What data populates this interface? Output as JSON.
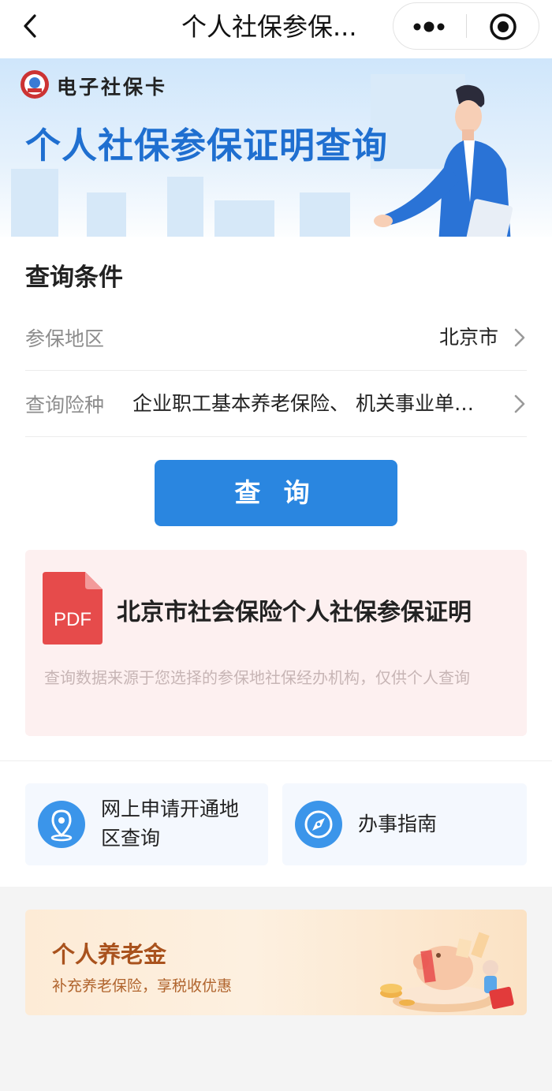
{
  "navbar": {
    "title": "个人社保参保...",
    "back_icon": "chevron-left-icon",
    "more_icon": "more-dots-icon",
    "close_icon": "target-circle-icon"
  },
  "banner": {
    "brand": "电子社保卡",
    "title": "个人社保参保证明查询",
    "logo_icon": "social-security-seal-icon"
  },
  "query": {
    "section_title": "查询条件",
    "fields": [
      {
        "label": "参保地区",
        "value": "北京市"
      },
      {
        "label": "查询险种",
        "value": "企业职工基本养老保险、 机关事业单…"
      }
    ],
    "button_label": "查 询"
  },
  "certificate": {
    "icon_label": "PDF",
    "title": "北京市社会保险个人社保参保证明",
    "note": "查询数据来源于您选择的参保地社保经办机构，仅供个人查询"
  },
  "links": [
    {
      "label": "网上申请开通地区查询",
      "icon": "location-pin-icon"
    },
    {
      "label": "办事指南",
      "icon": "compass-icon"
    }
  ],
  "promo": {
    "title": "个人养老金",
    "subtitle": "补充养老保险，享税收优惠"
  },
  "colors": {
    "primary": "#2a86e0",
    "banner_title": "#1f6fd0",
    "pdf_red": "#e64b4b",
    "promo_title": "#a9521d"
  }
}
